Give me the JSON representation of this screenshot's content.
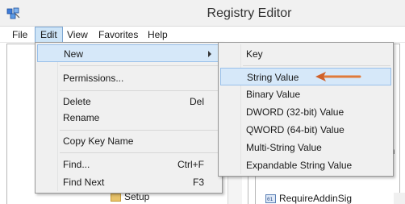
{
  "window": {
    "title": "Registry Editor"
  },
  "menubar": {
    "items": [
      {
        "label": "File",
        "active": false
      },
      {
        "label": "Edit",
        "active": true
      },
      {
        "label": "View",
        "active": false
      },
      {
        "label": "Favorites",
        "active": false
      },
      {
        "label": "Help",
        "active": false
      }
    ]
  },
  "edit_menu": {
    "items": [
      {
        "label": "New",
        "shortcut": "",
        "submenu": true,
        "highlighted": true
      },
      {
        "label": "Permissions...",
        "shortcut": ""
      },
      {
        "label": "Delete",
        "shortcut": "Del"
      },
      {
        "label": "Rename",
        "shortcut": ""
      },
      {
        "label": "Copy Key Name",
        "shortcut": ""
      },
      {
        "label": "Find...",
        "shortcut": "Ctrl+F"
      },
      {
        "label": "Find Next",
        "shortcut": "F3"
      }
    ]
  },
  "new_submenu": {
    "items": [
      {
        "label": "Key"
      },
      {
        "label": "String Value",
        "highlighted": true
      },
      {
        "label": "Binary Value"
      },
      {
        "label": "DWORD (32-bit) Value"
      },
      {
        "label": "QWORD (64-bit) Value"
      },
      {
        "label": "Multi-String Value"
      },
      {
        "label": "Expandable String Value"
      }
    ]
  },
  "tree": {
    "visible_item": "Setup"
  },
  "values_pane": {
    "visible_value": "RequireAddinSig",
    "clipped_text": "in"
  },
  "colors": {
    "highlight": "#d6e8f9",
    "highlight_border": "#99c0ea",
    "annotation_arrow": "#e07a3a"
  }
}
